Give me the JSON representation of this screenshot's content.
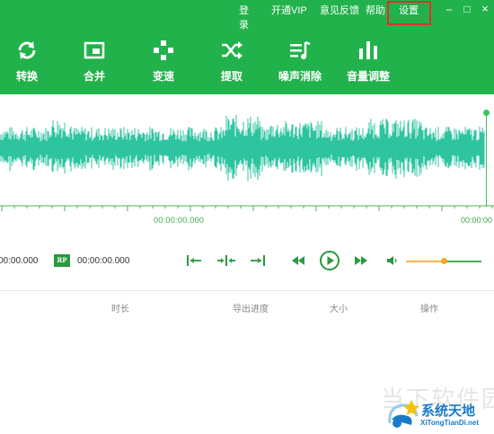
{
  "menu": {
    "login": "登录",
    "vip": "开通VIP",
    "feedback": "意见反馈",
    "help": "帮助",
    "settings": "设置"
  },
  "window_controls": {
    "minimize": "–",
    "maximize": "□",
    "close": "×"
  },
  "toolbar": {
    "items": [
      {
        "label": "转换",
        "icon": "refresh-icon"
      },
      {
        "label": "合并",
        "icon": "merge-icon"
      },
      {
        "label": "变速",
        "icon": "gamepad-icon"
      },
      {
        "label": "提取",
        "icon": "shuffle-icon"
      },
      {
        "label": "噪声消除",
        "icon": "music-list-icon"
      },
      {
        "label": "音量调整",
        "icon": "bars-icon"
      }
    ]
  },
  "timeline": {
    "mid_time": "00:00:00.000",
    "right_time": "00:00:00"
  },
  "controls": {
    "start_time": "00:00.000",
    "rp_label": "RP",
    "end_time": "00:00:00.000",
    "volume_level": 0.5
  },
  "table": {
    "columns": [
      "时长",
      "导出进度",
      "大小",
      "操作"
    ]
  },
  "watermark": {
    "background_text": "当下软件园",
    "title": "系统天地",
    "url": "XiTongTianDi.net"
  },
  "colors": {
    "brand_green": "#22b24c",
    "wave_teal": "#2ec4a0",
    "accent_orange": "#f5a623",
    "highlight_red": "#e0302e"
  }
}
